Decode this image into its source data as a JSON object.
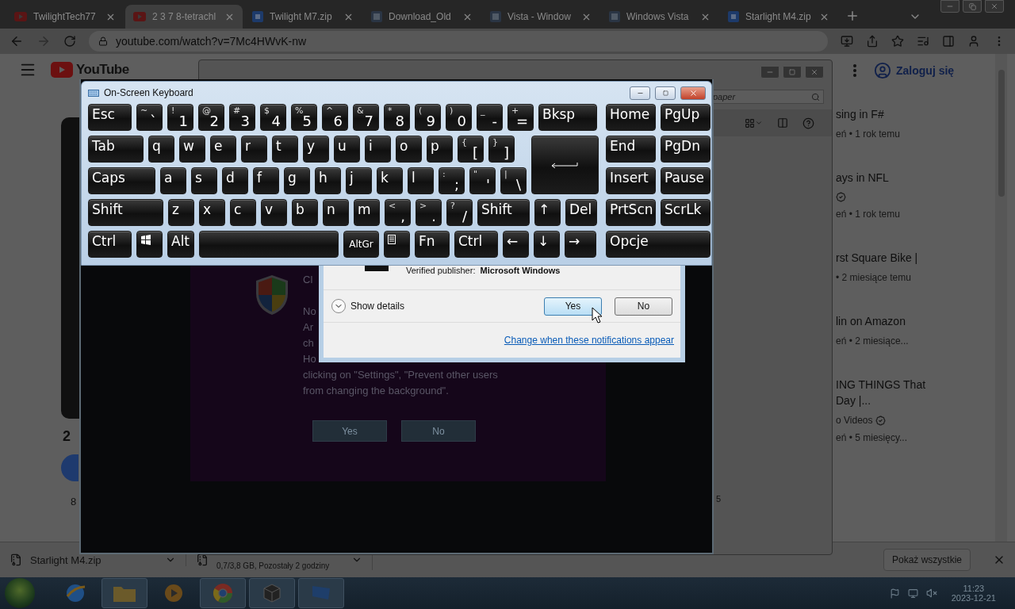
{
  "browser": {
    "tabs": [
      {
        "title": "TwilightTech77",
        "kind": "video",
        "selected": false
      },
      {
        "title": "2 3 7 8-tetrachl",
        "kind": "video",
        "selected": true
      },
      {
        "title": "Twilight M7.zip",
        "kind": "archive",
        "selected": false
      },
      {
        "title": "Download_Old",
        "kind": "page",
        "selected": false
      },
      {
        "title": "Vista - Window",
        "kind": "page",
        "selected": false
      },
      {
        "title": "Windows Vista",
        "kind": "page",
        "selected": false
      },
      {
        "title": "Starlight M4.zip",
        "kind": "archive",
        "selected": false
      }
    ],
    "address": "youtube.com/watch?v=7Mc4HWvK-nw"
  },
  "youtube": {
    "logo": "YouTube",
    "video_title": "2",
    "count": "8",
    "sign_in": "Zaloguj się",
    "recommendations": [
      {
        "title": "sing in F#",
        "verified": false,
        "meta": "eń • 1 rok temu"
      },
      {
        "title": "ays in NFL",
        "verified": true,
        "meta": "eń • 1 rok temu"
      },
      {
        "title": "rst Square Bike |",
        "verified": false,
        "meta": "• 2 miesiące temu"
      },
      {
        "title": "lin on Amazon",
        "verified": false,
        "meta": "eń • 2 miesiące..."
      },
      {
        "title": "ING THINGS That Day |...",
        "channel": "o Videos",
        "verified": true,
        "meta": "eń • 5 miesięcy..."
      }
    ]
  },
  "download_bar": {
    "file": "Starlight M4.zip",
    "status": "0,7/3,8 GB, Pozostały 2 godziny",
    "show_all": "Pokaż wszystkie"
  },
  "vm_window": {
    "search_placeholder": "paper",
    "corner_text": "5"
  },
  "remote_screen": {
    "heading": "Cl",
    "lines": [
      "No",
      "Ar",
      "ch",
      "Ho",
      "clicking on \"Settings\", \"Prevent other users",
      "from changing the background\"."
    ],
    "buttons": [
      "Yes",
      "No"
    ]
  },
  "uac": {
    "publisher_label": "Verified publisher:",
    "publisher": "Microsoft Windows",
    "details": "Show details",
    "buttons": [
      {
        "label": "Yes",
        "focused": true
      },
      {
        "label": "No",
        "focused": false
      }
    ],
    "link": "Change when these notifications appear"
  },
  "keyboard": {
    "title": "On-Screen Keyboard",
    "rows": [
      {
        "keys": [
          {
            "kind": "text",
            "label": "Esc"
          },
          {
            "kind": "dual",
            "top": "~",
            "main": "`"
          },
          {
            "kind": "dual",
            "top": "!",
            "main": "1"
          },
          {
            "kind": "dual",
            "top": "@",
            "main": "2"
          },
          {
            "kind": "dual",
            "top": "#",
            "main": "3"
          },
          {
            "kind": "dual",
            "top": "$",
            "main": "4"
          },
          {
            "kind": "dual",
            "top": "%",
            "main": "5"
          },
          {
            "kind": "dual",
            "top": "^",
            "main": "6"
          },
          {
            "kind": "dual",
            "top": "&",
            "main": "7"
          },
          {
            "kind": "dual",
            "top": "*",
            "main": "8"
          },
          {
            "kind": "dual",
            "top": "(",
            "main": "9"
          },
          {
            "kind": "dual",
            "top": ")",
            "main": "0"
          },
          {
            "kind": "dual",
            "top": "_",
            "main": "-"
          },
          {
            "kind": "dual",
            "top": "+",
            "main": "="
          },
          {
            "kind": "text",
            "label": "Bksp"
          }
        ]
      },
      {
        "keys": [
          {
            "kind": "text",
            "label": "Tab"
          },
          {
            "kind": "text",
            "label": "q"
          },
          {
            "kind": "text",
            "label": "w"
          },
          {
            "kind": "text",
            "label": "e"
          },
          {
            "kind": "text",
            "label": "r"
          },
          {
            "kind": "text",
            "label": "t"
          },
          {
            "kind": "text",
            "label": "y"
          },
          {
            "kind": "text",
            "label": "u"
          },
          {
            "kind": "text",
            "label": "i"
          },
          {
            "kind": "text",
            "label": "o"
          },
          {
            "kind": "text",
            "label": "p"
          },
          {
            "kind": "dual",
            "top": "{",
            "main": "["
          },
          {
            "kind": "dual",
            "top": "}",
            "main": "]"
          },
          {
            "kind": "enter"
          }
        ]
      },
      {
        "keys": [
          {
            "kind": "text",
            "label": "Caps"
          },
          {
            "kind": "text",
            "label": "a"
          },
          {
            "kind": "text",
            "label": "s"
          },
          {
            "kind": "text",
            "label": "d"
          },
          {
            "kind": "text",
            "label": "f"
          },
          {
            "kind": "text",
            "label": "g"
          },
          {
            "kind": "text",
            "label": "h"
          },
          {
            "kind": "text",
            "label": "j"
          },
          {
            "kind": "text",
            "label": "k"
          },
          {
            "kind": "text",
            "label": "l"
          },
          {
            "kind": "dual",
            "top": ":",
            "main": ";"
          },
          {
            "kind": "dual",
            "top": "\"",
            "main": "'"
          },
          {
            "kind": "dual",
            "top": "|",
            "main": "\\"
          }
        ]
      },
      {
        "keys": [
          {
            "kind": "text",
            "label": "Shift"
          },
          {
            "kind": "text",
            "label": "z"
          },
          {
            "kind": "text",
            "label": "x"
          },
          {
            "kind": "text",
            "label": "c"
          },
          {
            "kind": "text",
            "label": "v"
          },
          {
            "kind": "text",
            "label": "b"
          },
          {
            "kind": "text",
            "label": "n"
          },
          {
            "kind": "text",
            "label": "m"
          },
          {
            "kind": "dual",
            "top": "<",
            "main": ","
          },
          {
            "kind": "dual",
            "top": ">",
            "main": "."
          },
          {
            "kind": "dual",
            "top": "?",
            "main": "/"
          },
          {
            "kind": "text",
            "label": "Shift"
          },
          {
            "kind": "text",
            "label": "↑"
          },
          {
            "kind": "text",
            "label": "Del"
          }
        ]
      },
      {
        "keys": [
          {
            "kind": "text",
            "label": "Ctrl"
          },
          {
            "kind": "windows"
          },
          {
            "kind": "text",
            "label": "Alt"
          },
          {
            "kind": "space"
          },
          {
            "kind": "small",
            "label": "AltGr"
          },
          {
            "kind": "menu"
          },
          {
            "kind": "text",
            "label": "Fn"
          },
          {
            "kind": "text",
            "label": "Ctrl"
          },
          {
            "kind": "text",
            "label": "←"
          },
          {
            "kind": "text",
            "label": "↓"
          },
          {
            "kind": "text",
            "label": "→"
          }
        ]
      }
    ],
    "side_rows": [
      {
        "keys": [
          "Home",
          "PgUp"
        ]
      },
      {
        "keys": [
          "End",
          "PgDn"
        ]
      },
      {
        "keys": [
          "Insert",
          "Pause"
        ]
      },
      {
        "keys": [
          "PrtScn",
          "ScrLk"
        ]
      },
      {
        "keys": [
          "Opcje"
        ]
      }
    ]
  },
  "taskbar": {
    "apps": [
      {
        "kind": "globe",
        "active": false
      },
      {
        "kind": "folder",
        "active": true
      },
      {
        "kind": "media",
        "active": false
      },
      {
        "kind": "chrome",
        "active": true
      },
      {
        "kind": "cube",
        "active": true
      },
      {
        "kind": "monitor",
        "active": true
      }
    ],
    "time": "11:23",
    "date": "2023-12-21"
  }
}
